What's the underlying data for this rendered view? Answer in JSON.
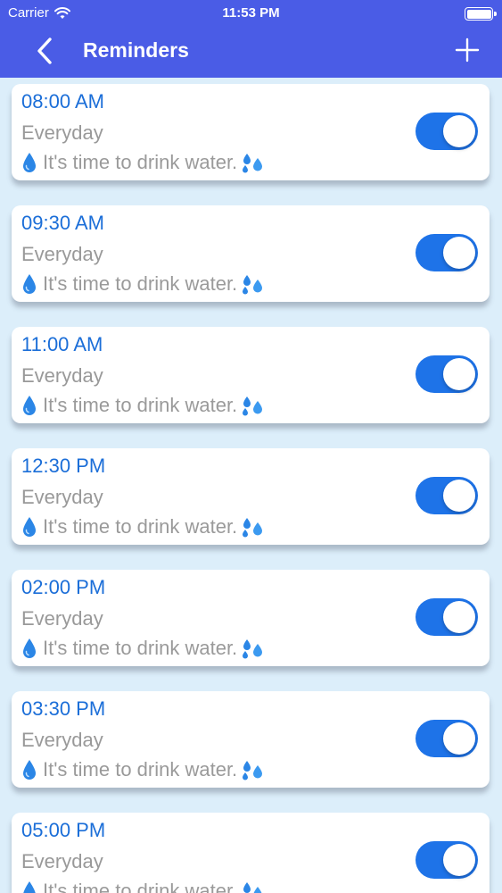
{
  "status_bar": {
    "carrier": "Carrier",
    "time": "11:53 PM"
  },
  "nav": {
    "title": "Reminders"
  },
  "reminders": [
    {
      "time": "08:00 AM",
      "repeat": "Everyday",
      "message": "It's time to drink water.",
      "enabled": true
    },
    {
      "time": "09:30 AM",
      "repeat": "Everyday",
      "message": "It's time to drink water.",
      "enabled": true
    },
    {
      "time": "11:00 AM",
      "repeat": "Everyday",
      "message": "It's time to drink water.",
      "enabled": true
    },
    {
      "time": "12:30 PM",
      "repeat": "Everyday",
      "message": "It's time to drink water.",
      "enabled": true
    },
    {
      "time": "02:00 PM",
      "repeat": "Everyday",
      "message": "It's time to drink water.",
      "enabled": true
    },
    {
      "time": "03:30 PM",
      "repeat": "Everyday",
      "message": "It's time to drink water.",
      "enabled": true
    },
    {
      "time": "05:00 PM",
      "repeat": "Everyday",
      "message": "It's time to drink water.",
      "enabled": true
    }
  ],
  "icons": {
    "back": "chevron-left-icon",
    "add": "plus-icon",
    "wifi": "wifi-icon",
    "battery": "battery-icon",
    "message_prefix": "droplet-icon",
    "message_suffix": "sweat-droplets-icon"
  },
  "colors": {
    "header": "#4a5ce6",
    "background": "#dceefa",
    "time_text": "#1b6ed8",
    "toggle_on": "#1e73e8",
    "secondary_text": "#999999"
  }
}
